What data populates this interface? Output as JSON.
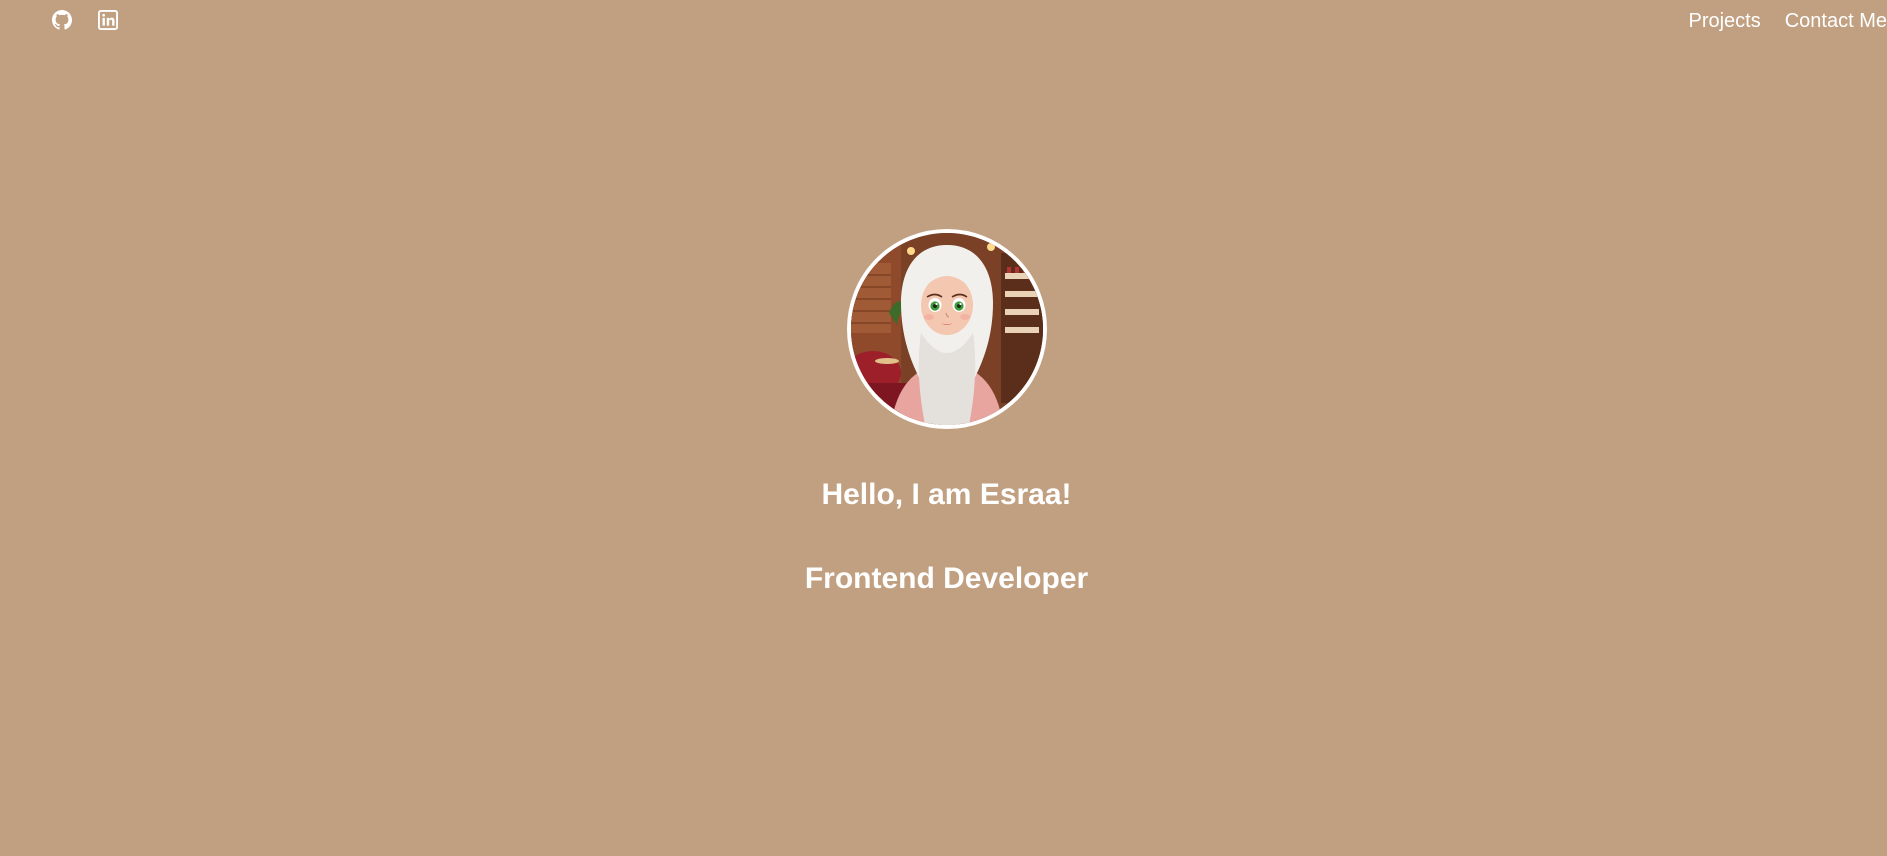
{
  "social": {
    "github_icon": "github-icon",
    "linkedin_icon": "linkedin-icon"
  },
  "nav": {
    "projects_label": "Projects",
    "contact_label": "Contact Me"
  },
  "hero": {
    "greeting": "Hello, I am Esraa!",
    "role": "Frontend Developer"
  },
  "colors": {
    "background": "#c1a081",
    "text": "#ffffff"
  }
}
